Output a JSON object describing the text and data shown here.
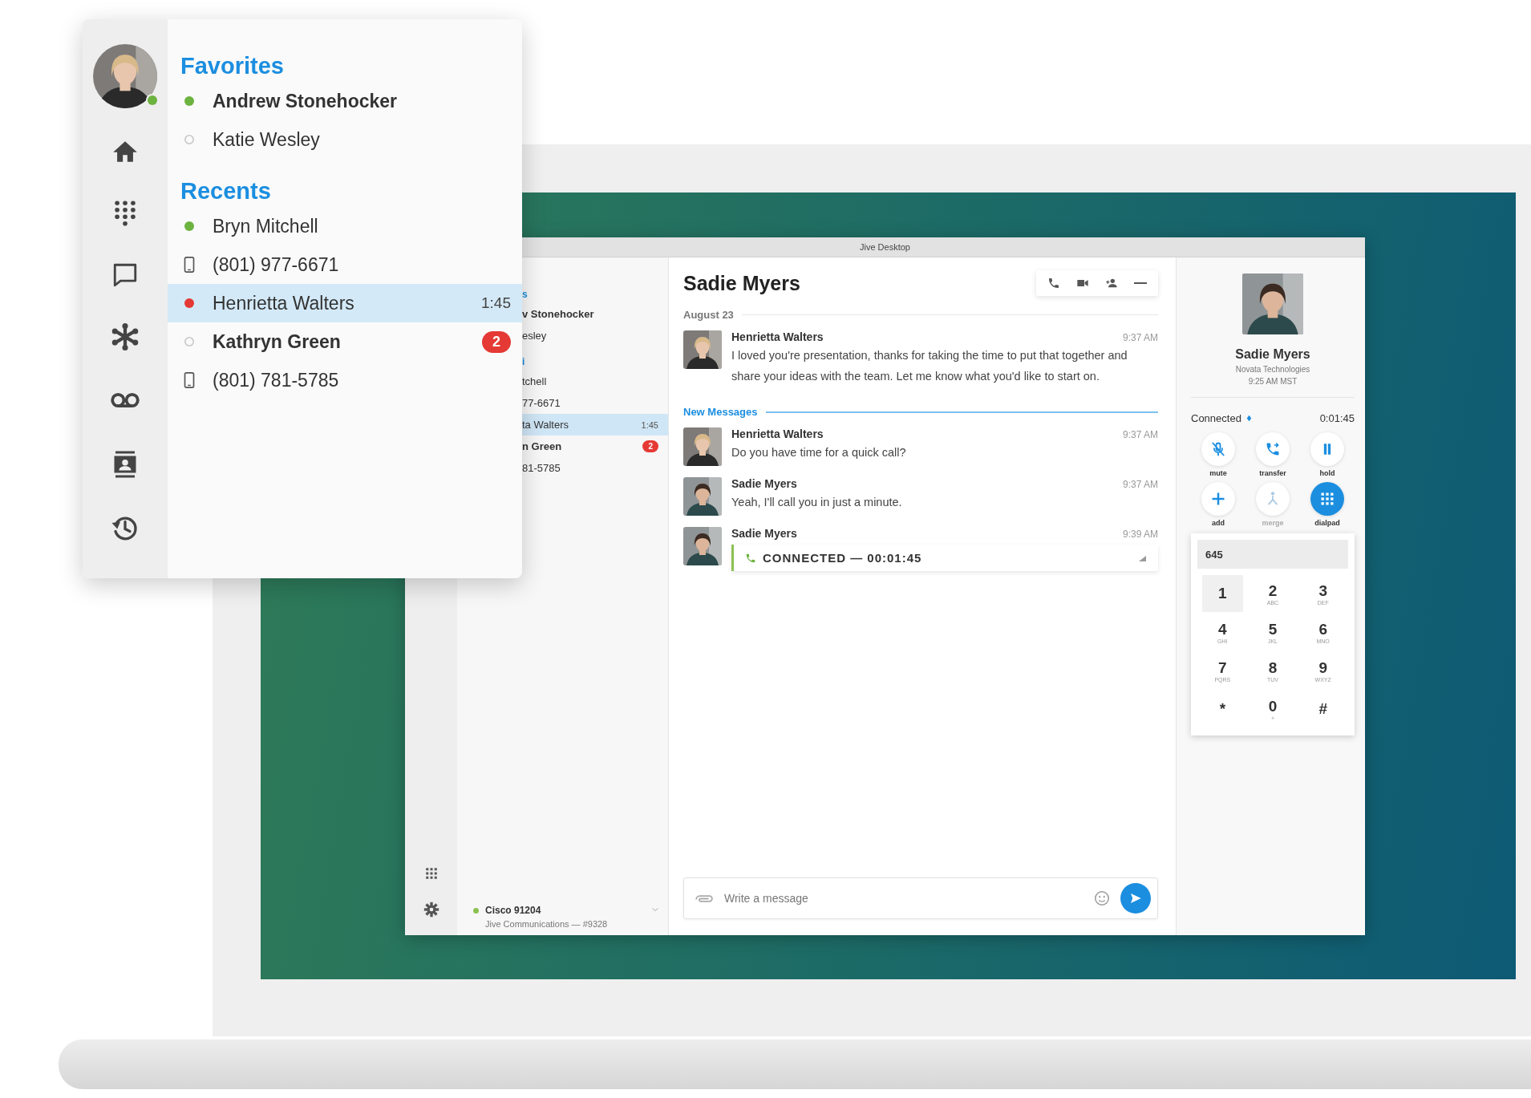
{
  "popup": {
    "user": {
      "color": "#6cb33f",
      "filled": true
    },
    "sections": [
      {
        "title": "Favorites",
        "items": [
          {
            "kind": "contact",
            "name": "Andrew Stonehocker",
            "color": "#6cb33f",
            "filled": true,
            "unread": true,
            "selected": false
          },
          {
            "kind": "contact",
            "name": "Katie Wesley",
            "color": "#c8c8c8",
            "filled": false,
            "unread": false,
            "selected": false
          }
        ]
      },
      {
        "title": "Recents",
        "items": [
          {
            "kind": "contact",
            "name": "Bryn Mitchell",
            "color": "#6cb33f",
            "filled": true,
            "unread": false,
            "selected": false
          },
          {
            "kind": "number",
            "name": "(801) 977-6671",
            "unread": false,
            "selected": false
          },
          {
            "kind": "contact",
            "name": "Henrietta Walters",
            "color": "#e53935",
            "filled": true,
            "unread": false,
            "selected": true,
            "time": "1:45"
          },
          {
            "kind": "contact",
            "name": "Kathryn Green",
            "color": "#c8c8c8",
            "filled": false,
            "unread": true,
            "selected": false,
            "badge": "2"
          },
          {
            "kind": "number",
            "name": "(801) 781-5785",
            "unread": false,
            "selected": false
          }
        ]
      }
    ]
  },
  "app": {
    "title": "Jive Desktop",
    "list": [
      {
        "kind": "heading",
        "text": "s"
      },
      {
        "kind": "item",
        "text": "v Stonehocker",
        "unread": true,
        "selected": false
      },
      {
        "kind": "item",
        "text": "esley",
        "unread": false,
        "selected": false
      },
      {
        "kind": "heading",
        "text": "i"
      },
      {
        "kind": "item",
        "text": "tchell",
        "unread": false,
        "selected": false
      },
      {
        "kind": "item",
        "text": "77-6671",
        "unread": false,
        "selected": false
      },
      {
        "kind": "item",
        "text": "ta Walters",
        "unread": false,
        "selected": true,
        "time": "1:45"
      },
      {
        "kind": "item",
        "text": "n Green",
        "unread": true,
        "selected": false,
        "badge": "2"
      },
      {
        "kind": "item",
        "text": "81-5785",
        "unread": false,
        "selected": false
      }
    ],
    "device": {
      "name": "Cisco 91204",
      "color": "#8cc152",
      "detail": "Jive Communications — #9328"
    },
    "chat": {
      "title": "Sadie Myers",
      "date": "August 23",
      "messages": [
        {
          "kind": "text",
          "sender": "Henrietta Walters",
          "time": "9:37 AM",
          "text": "I loved you're presentation, thanks for taking the time to put that together and share your ideas with the team. Let me know what you'd like to start on."
        },
        {
          "kind": "divider",
          "text": "New Messages"
        },
        {
          "kind": "text",
          "sender": "Henrietta Walters",
          "time": "9:37 AM",
          "text": "Do you have time for a quick call?"
        },
        {
          "kind": "text",
          "sender": "Sadie Myers",
          "time": "9:37 AM",
          "text": "Yeah, I'll call you in just a minute."
        },
        {
          "kind": "call",
          "sender": "Sadie Myers",
          "time": "9:39 AM",
          "text": "CONNECTED — 00:01:45"
        }
      ],
      "composer": {
        "placeholder": "Write a message"
      }
    },
    "call": {
      "name": "Sadie Myers",
      "company": "Novata Technologies",
      "local_time": "9:25 AM MST",
      "status": "Connected",
      "duration": "0:01:45",
      "controls": [
        {
          "kind": "mute",
          "label": "mute",
          "selected": false,
          "disabled": false
        },
        {
          "kind": "transfer",
          "label": "transfer",
          "selected": false,
          "disabled": false
        },
        {
          "kind": "hold",
          "label": "hold",
          "selected": false,
          "disabled": false
        },
        {
          "kind": "add",
          "label": "add",
          "selected": false,
          "disabled": false
        },
        {
          "kind": "merge",
          "label": "merge",
          "selected": false,
          "disabled": true
        },
        {
          "kind": "dialpad",
          "label": "dialpad",
          "selected": true,
          "disabled": false
        }
      ],
      "dialpad": {
        "value": "645",
        "keys": [
          {
            "digit": "1",
            "pressed": true
          },
          {
            "digit": "2",
            "letters": "ABC",
            "pressed": false
          },
          {
            "digit": "3",
            "letters": "DEF",
            "pressed": false
          },
          {
            "digit": "4",
            "letters": "GHI",
            "pressed": false
          },
          {
            "digit": "5",
            "letters": "JKL",
            "pressed": false
          },
          {
            "digit": "6",
            "letters": "MNO",
            "pressed": false
          },
          {
            "digit": "7",
            "letters": "PQRS",
            "pressed": false
          },
          {
            "digit": "8",
            "letters": "TUV",
            "pressed": false
          },
          {
            "digit": "9",
            "letters": "WXYZ",
            "pressed": false
          },
          {
            "digit": "*",
            "pressed": false
          },
          {
            "digit": "0",
            "letters": "+",
            "pressed": false
          },
          {
            "digit": "#",
            "pressed": false
          }
        ]
      }
    }
  }
}
